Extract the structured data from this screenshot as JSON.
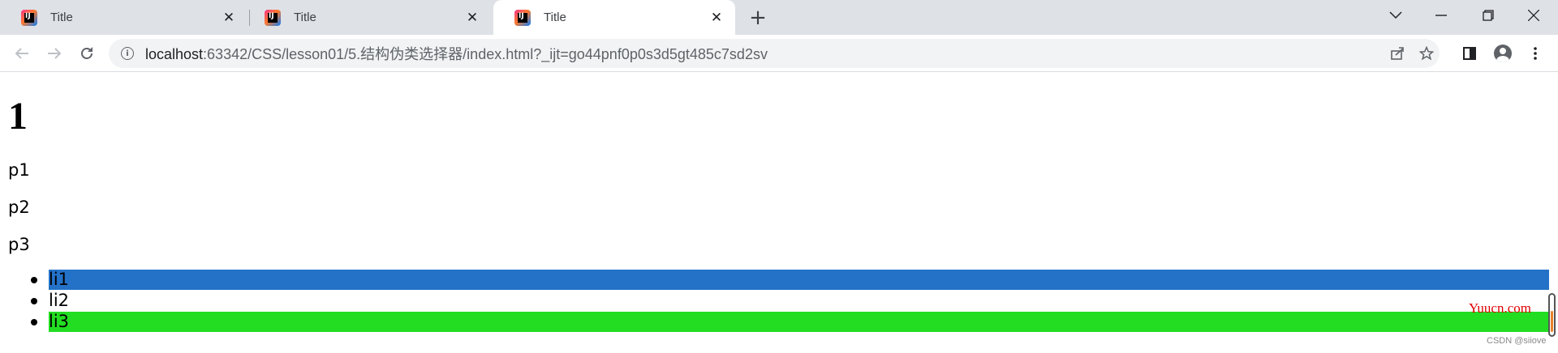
{
  "browser": {
    "tabs": [
      {
        "title": "Title",
        "active": false
      },
      {
        "title": "Title",
        "active": false
      },
      {
        "title": "Title",
        "active": true
      }
    ],
    "favicon_letter": "IJ",
    "address": {
      "host": "localhost",
      "path": ":63342/CSS/lesson01/5.结构伪类选择器/index.html?_ijt=go44pnf0p0s3d5gt485c7sd2sv"
    }
  },
  "page": {
    "heading": "1",
    "paragraphs": [
      "p1",
      "p2",
      "p3"
    ],
    "list_items": [
      {
        "label": "li1",
        "background": "#2472c8"
      },
      {
        "label": "li2",
        "background": "#ffffff"
      },
      {
        "label": "li3",
        "background": "#22dd22"
      }
    ]
  },
  "overlay": {
    "watermark": "Yuucn.com",
    "credit": "CSDN @siiove"
  },
  "colors": {
    "tabstrip": "#dee1e6",
    "active_tab_indicator": "#1a73e8",
    "watermark": "#e00000"
  },
  "icons": [
    "intellij-icon",
    "close-icon",
    "new-tab-icon",
    "chevron-down-icon",
    "minimize-icon",
    "restore-icon",
    "window-close-icon",
    "back-icon",
    "forward-icon",
    "reload-icon",
    "info-icon",
    "share-icon",
    "star-icon",
    "side-panel-icon",
    "profile-icon",
    "menu-icon"
  ]
}
